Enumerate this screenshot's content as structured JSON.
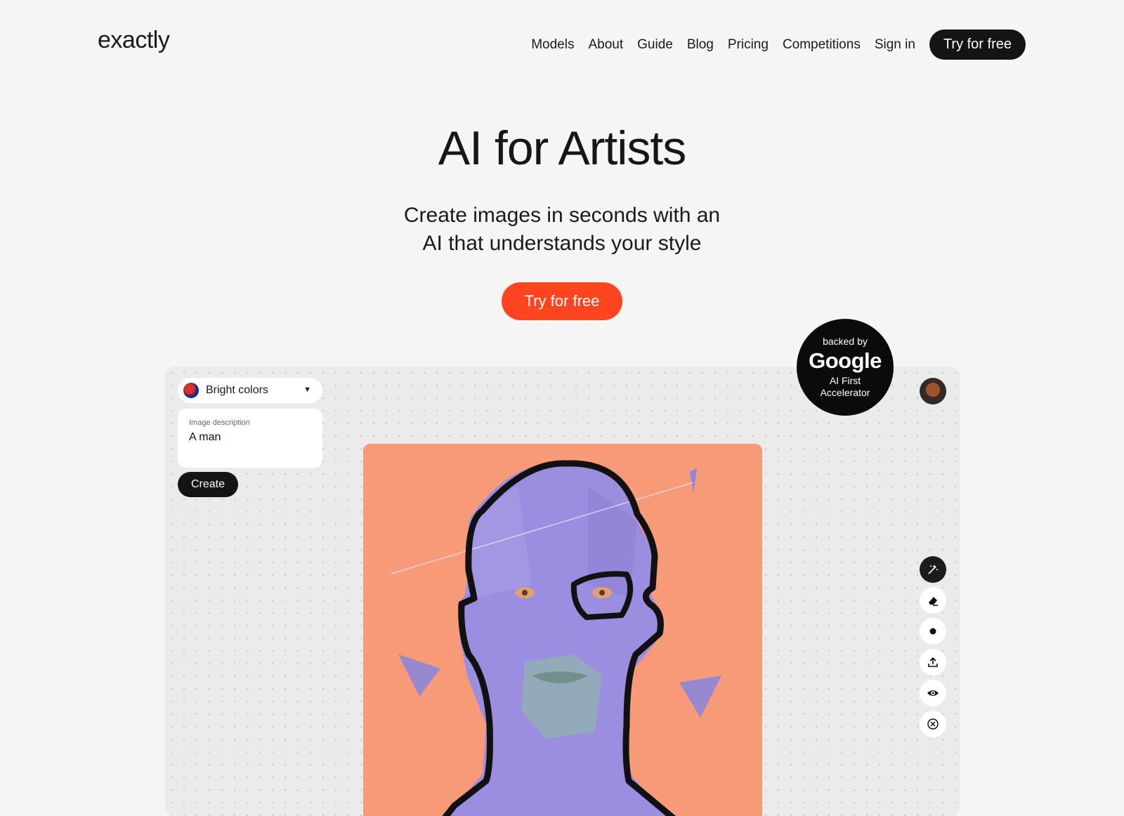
{
  "header": {
    "logo": "exactly",
    "nav": [
      "Models",
      "About",
      "Guide",
      "Blog",
      "Pricing",
      "Competitions",
      "Sign in"
    ],
    "cta": "Try for free"
  },
  "hero": {
    "title": "AI for Artists",
    "subtitle_line1": "Create images in seconds with an",
    "subtitle_line2": "AI that understands your style",
    "cta": "Try for free",
    "accent_color": "#ff4420"
  },
  "badge": {
    "line1": "backed by",
    "brand": "Google",
    "line3": "AI First",
    "line4": "Accelerator"
  },
  "editor": {
    "style_select": "Bright colors",
    "description_label": "Image description",
    "description_value": "A man",
    "create_label": "Create",
    "tools": [
      "magic-wand-icon",
      "eraser-icon",
      "dot-icon",
      "upload-icon",
      "eye-icon",
      "close-circle-icon"
    ]
  }
}
